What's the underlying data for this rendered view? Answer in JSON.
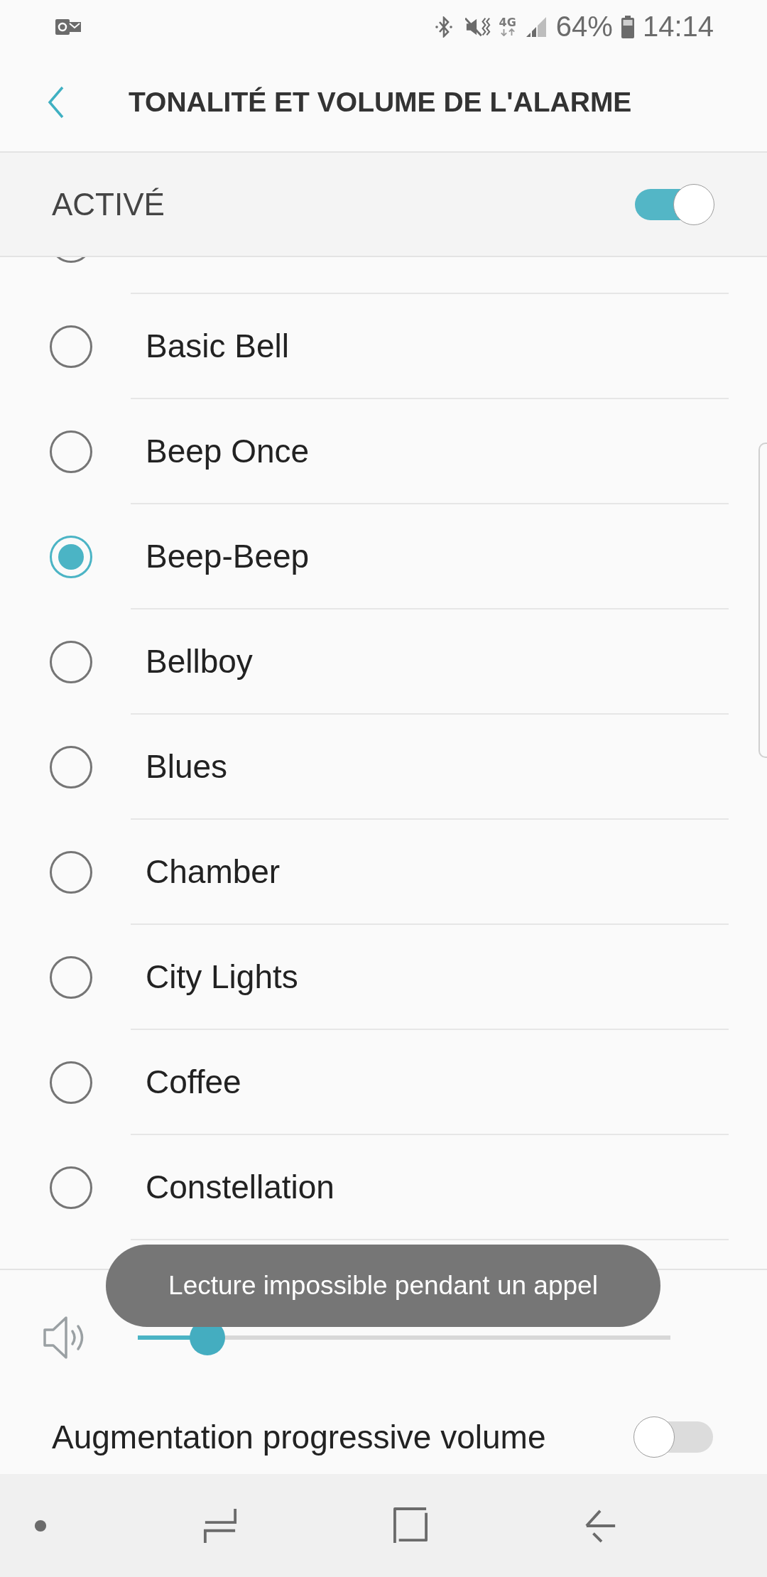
{
  "status_bar": {
    "network": "4G",
    "battery": "64%",
    "time": "14:14"
  },
  "header": {
    "title": "TONALITÉ ET VOLUME DE L'ALARME"
  },
  "master_switch": {
    "label": "ACTIVÉ",
    "on": true
  },
  "ringtones": [
    {
      "selected": false
    },
    {
      "label": "Basic Bell",
      "selected": false
    },
    {
      "label": "Beep Once",
      "selected": false
    },
    {
      "label": "Beep-Beep",
      "selected": true
    },
    {
      "label": "Bellboy",
      "selected": false
    },
    {
      "label": "Blues",
      "selected": false
    },
    {
      "label": "Chamber",
      "selected": false
    },
    {
      "label": "City Lights",
      "selected": false
    },
    {
      "label": "Coffee",
      "selected": false
    },
    {
      "label": "Constellation",
      "selected": false
    }
  ],
  "volume": {
    "level": 0.13
  },
  "toast": "Lecture impossible pendant un appel",
  "gradual_volume": {
    "label": "Augmentation progressive volume",
    "on": false
  }
}
